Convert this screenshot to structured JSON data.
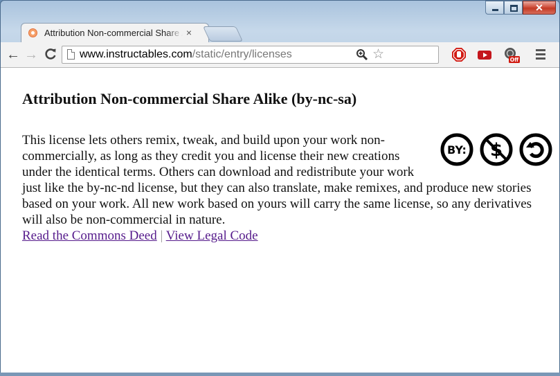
{
  "window": {
    "controls": {
      "minimize": "–",
      "maximize": "□",
      "close": "✕"
    }
  },
  "tab": {
    "title": "Attribution Non-commercial Share Alike (by-nc-sa)",
    "close_label": "×",
    "favicon": "instructables-favicon"
  },
  "toolbar": {
    "back_label": "←",
    "forward_label": "→",
    "reload_label": "C",
    "url_host": "www.instructables.com",
    "url_path": "/static/entry/licenses",
    "star_label": "☆",
    "extensions": [
      "adblock-icon",
      "youtube-icon",
      "off-extension-icon"
    ],
    "off_badge": "Off"
  },
  "page": {
    "heading": "Attribution Non-commercial Share Alike (by-nc-sa)",
    "body": "This license lets others remix, tweak, and build upon your work non-commercially, as long as they credit you and license their new creations under the identical terms. Others can download and redistribute your work just like the by-nc-nd license, but they can also translate, make remixes, and produce new stories based on your work. All new work based on yours will carry the same license, so any derivatives will also be non-commercial in nature.",
    "badges": {
      "by_label": "BY:",
      "nc_symbol": "$"
    },
    "links": {
      "deed": "Read the Commons Deed",
      "separator": "|",
      "legal": "View Legal Code"
    }
  },
  "colors": {
    "link": "#551a8b",
    "frame": "#a9c3dd",
    "close_button": "#c23a25"
  }
}
